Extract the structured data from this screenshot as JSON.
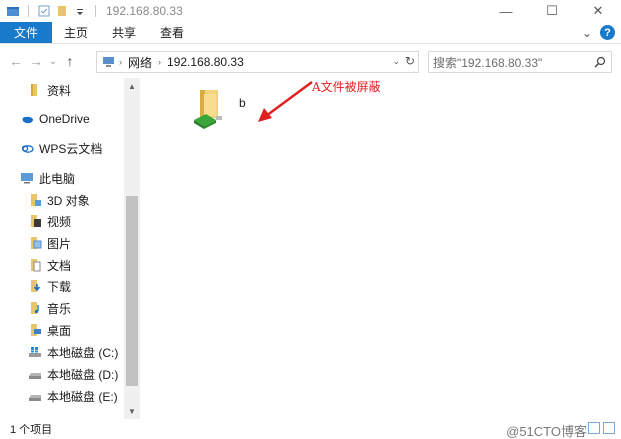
{
  "titlebar": {
    "title": "192.168.80.33",
    "minimize": "—",
    "maximize": "☐",
    "close": "✕"
  },
  "ribbon": {
    "tabs": [
      "文件",
      "主页",
      "共享",
      "查看"
    ],
    "expand": "⌄",
    "help": "?"
  },
  "address": {
    "back": "←",
    "forward": "→",
    "recent": "⌄",
    "up": "↑",
    "crumbs": [
      "网络",
      "192.168.80.33"
    ],
    "separator": "›",
    "dropdown": "⌄",
    "refresh": "↻",
    "search_placeholder": "搜索\"192.168.80.33\""
  },
  "sidebar": {
    "items": [
      {
        "label": "资料",
        "icon": "folder-icon"
      },
      {
        "label": "OneDrive",
        "icon": "cloud-icon"
      },
      {
        "label": "WPS云文档",
        "icon": "wps-cloud-icon"
      },
      {
        "label": "此电脑",
        "icon": "computer-icon"
      },
      {
        "label": "3D 对象",
        "icon": "3d-objects-icon"
      },
      {
        "label": "视频",
        "icon": "video-icon"
      },
      {
        "label": "图片",
        "icon": "pictures-icon"
      },
      {
        "label": "文档",
        "icon": "documents-icon"
      },
      {
        "label": "下载",
        "icon": "downloads-icon"
      },
      {
        "label": "音乐",
        "icon": "music-icon"
      },
      {
        "label": "桌面",
        "icon": "desktop-icon"
      },
      {
        "label": "本地磁盘 (C:)",
        "icon": "windows-drive-icon"
      },
      {
        "label": "本地磁盘 (D:)",
        "icon": "drive-icon"
      },
      {
        "label": "本地磁盘 (E:)",
        "icon": "drive-icon"
      }
    ]
  },
  "content": {
    "items": [
      {
        "label": "b",
        "icon": "shared-folder-icon"
      }
    ],
    "annotation": "A文件被屏蔽"
  },
  "status": {
    "count": "1 个项目",
    "watermark": "@51CTO博客"
  },
  "colors": {
    "accent": "#1979ca",
    "annotation": "#e02020"
  }
}
